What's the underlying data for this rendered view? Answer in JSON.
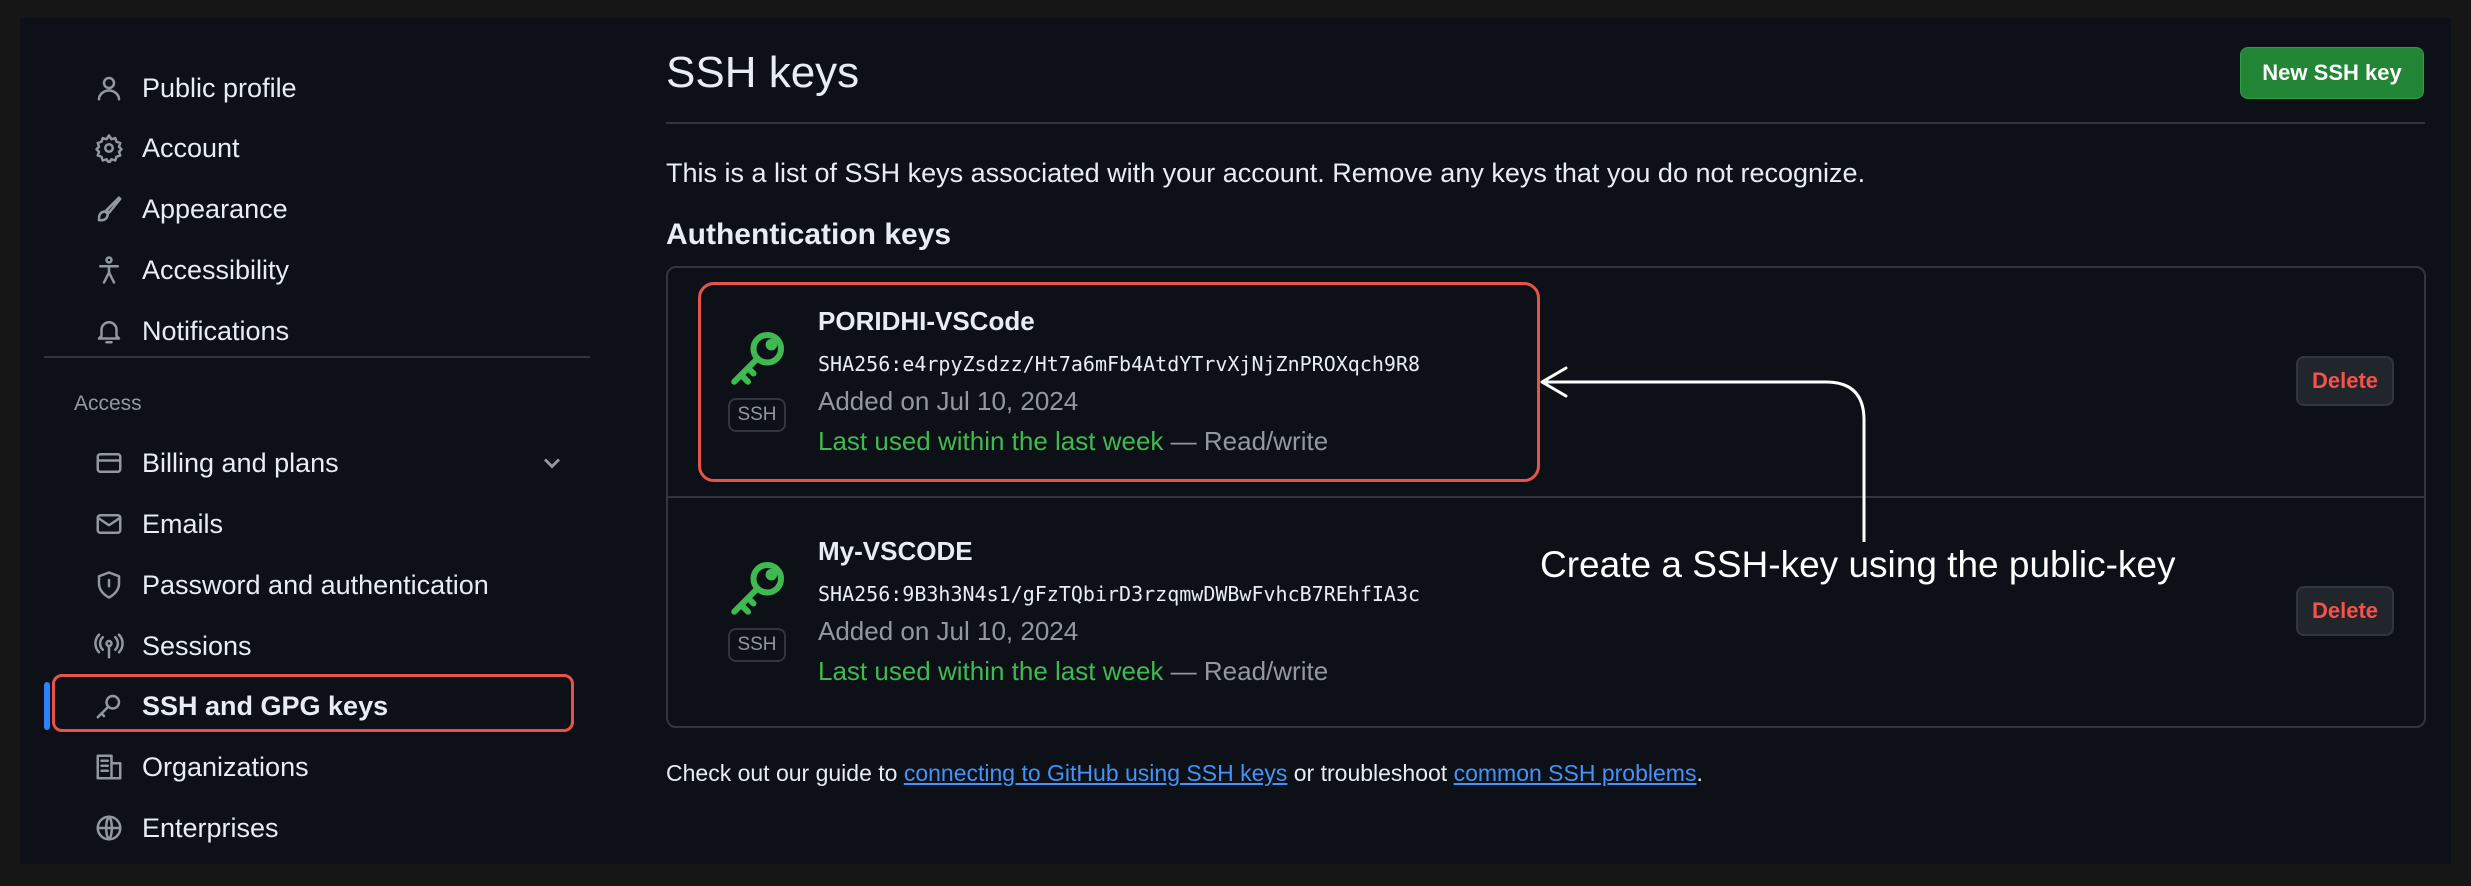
{
  "sidebar": {
    "items": [
      {
        "label": "Public profile",
        "icon": "person-icon"
      },
      {
        "label": "Account",
        "icon": "gear-icon"
      },
      {
        "label": "Appearance",
        "icon": "paintbrush-icon"
      },
      {
        "label": "Accessibility",
        "icon": "accessibility-icon"
      },
      {
        "label": "Notifications",
        "icon": "bell-icon"
      }
    ],
    "access_label": "Access",
    "access_items": [
      {
        "label": "Billing and plans",
        "icon": "credit-card-icon"
      },
      {
        "label": "Emails",
        "icon": "mail-icon"
      },
      {
        "label": "Password and authentication",
        "icon": "shield-icon"
      },
      {
        "label": "Sessions",
        "icon": "broadcast-icon"
      },
      {
        "label": "SSH and GPG keys",
        "icon": "key-icon"
      },
      {
        "label": "Organizations",
        "icon": "organization-icon"
      },
      {
        "label": "Enterprises",
        "icon": "globe-icon"
      }
    ]
  },
  "main": {
    "title": "SSH keys",
    "new_key_button": "New SSH key",
    "description": "This is a list of SSH keys associated with your account. Remove any keys that you do not recognize.",
    "section_heading": "Authentication keys",
    "keys": [
      {
        "name": "PORIDHI-VSCode",
        "fingerprint": "SHA256:e4rpyZsdzz/Ht7a6mFb4AtdYTrvXjNjZnPROXqch9R8",
        "added": "Added on Jul 10, 2024",
        "last_used": "Last used within the last week",
        "access": "— Read/write",
        "badge": "SSH",
        "delete_label": "Delete"
      },
      {
        "name": "My-VSCODE",
        "fingerprint": "SHA256:9B3h3N4s1/gFzTQbirD3rzqmwDWBwFvhcB7REhfIA3c",
        "added": "Added on Jul 10, 2024",
        "last_used": "Last used within the last week",
        "access": "— Read/write",
        "badge": "SSH",
        "delete_label": "Delete"
      }
    ],
    "guide": {
      "prefix": "Check out our guide to ",
      "link1": "connecting to GitHub using SSH keys",
      "middle": " or troubleshoot ",
      "link2": "common SSH problems",
      "suffix": "."
    }
  },
  "annotation": {
    "text": "Create a SSH-key using the public-key"
  },
  "colors": {
    "background": "#0d1117",
    "primary_button": "#238636",
    "success_text": "#3fb950",
    "danger_text": "#f85149",
    "link": "#4493f8",
    "highlight": "#e5534b"
  }
}
